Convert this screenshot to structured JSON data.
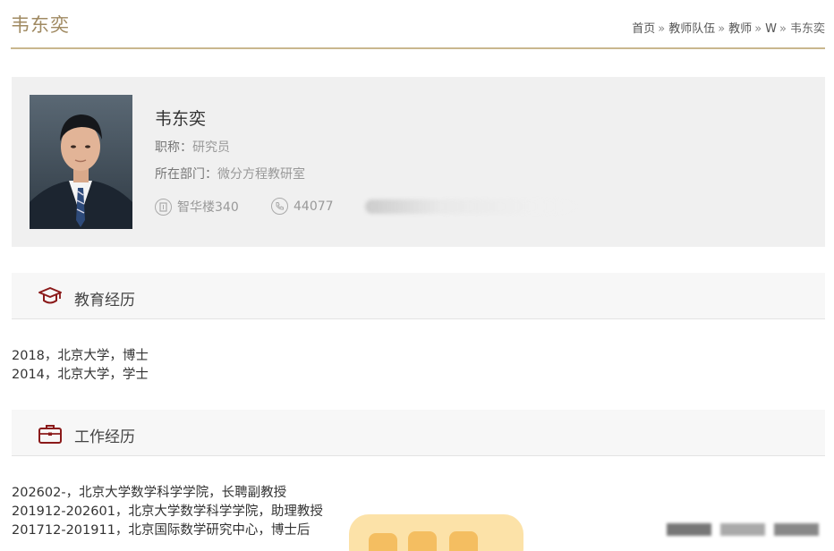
{
  "page": {
    "title": "韦东奕"
  },
  "breadcrumb": {
    "items": [
      "首页",
      "教师队伍",
      "教师",
      "W",
      "韦东奕"
    ],
    "separator": "»"
  },
  "profile": {
    "name": "韦东奕",
    "title_label": "职称：",
    "title_value": "研究员",
    "dept_label": "所在部门：",
    "dept_value": "微分方程教研室",
    "office": "智华楼340",
    "phone": "44077",
    "office_icon": "building-icon",
    "phone_icon": "phone-icon"
  },
  "education": {
    "heading": "教育经历",
    "icon": "graduation-cap-icon",
    "entries": [
      "2018，北京大学，博士",
      "2014，北京大学，学士"
    ]
  },
  "work": {
    "heading": "工作经历",
    "icon": "briefcase-icon",
    "entries": [
      "202602-，北京大学数学科学学院，长聘副教授",
      "201912-202601，北京大学数学科学学院，助理教授",
      "201712-201911，北京国际数学研究中心，博士后"
    ]
  },
  "colors": {
    "accent": "#a08a62",
    "rule": "#c9b78e",
    "icon": "#8b1a1a",
    "panel": "#f0f0f0"
  }
}
